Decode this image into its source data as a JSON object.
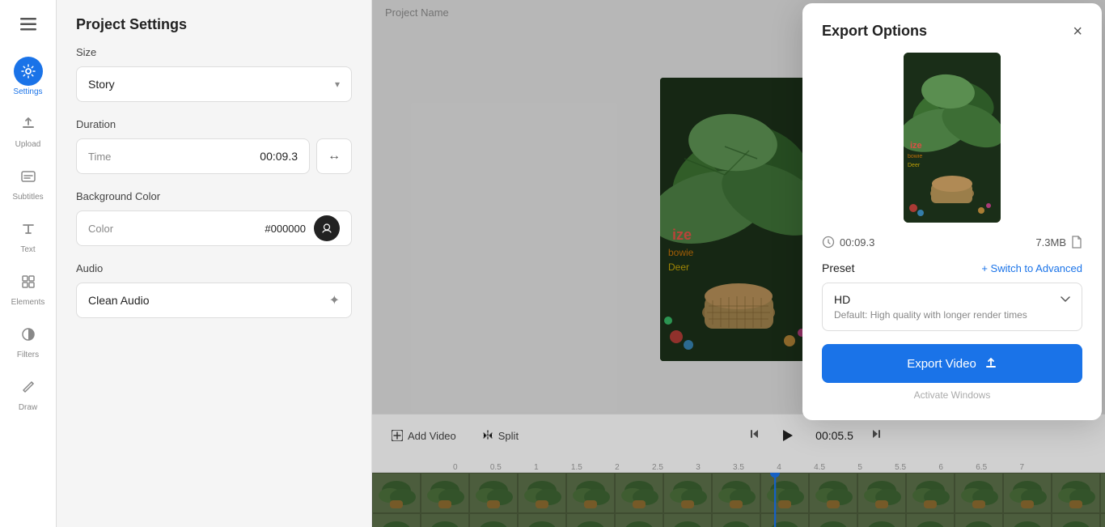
{
  "sidebar": {
    "menu_icon": "≡",
    "items": [
      {
        "id": "settings",
        "label": "Settings",
        "icon": "⚙",
        "active": true
      },
      {
        "id": "upload",
        "label": "Upload",
        "icon": "↑",
        "active": false
      },
      {
        "id": "subtitles",
        "label": "Subtitles",
        "icon": "≡",
        "active": false
      },
      {
        "id": "text",
        "label": "Text",
        "icon": "T",
        "active": false
      },
      {
        "id": "elements",
        "label": "Elements",
        "icon": "□",
        "active": false
      },
      {
        "id": "filters",
        "label": "Filters",
        "icon": "◑",
        "active": false
      },
      {
        "id": "draw",
        "label": "Draw",
        "icon": "✏",
        "active": false
      }
    ]
  },
  "settings_panel": {
    "title": "Project Settings",
    "size": {
      "label": "Size",
      "value": "Story"
    },
    "duration": {
      "label": "Duration",
      "time_label": "Time",
      "time_value": "00:09.3",
      "arrow_icon": "↔"
    },
    "background_color": {
      "label": "Background Color",
      "color_label": "Color",
      "hex_value": "#000000",
      "picker_icon": "⊕"
    },
    "audio": {
      "label": "Audio",
      "value": "Clean Audio",
      "sparkle_icon": "✦"
    }
  },
  "preview": {
    "project_name": "Project Name"
  },
  "timeline": {
    "add_video_label": "Add Video",
    "split_label": "Split",
    "time_display": "00:05.5",
    "ruler_marks": [
      "0",
      "0.5",
      "1",
      "1.5",
      "2",
      "2.5",
      "3",
      "3.5",
      "4",
      "4.5",
      "5",
      "5.5",
      "6",
      "6.5",
      "7"
    ]
  },
  "export_modal": {
    "title": "Export Options",
    "close_icon": "×",
    "duration": "00:09.3",
    "file_size": "7.3MB",
    "preset_label": "Preset",
    "switch_advanced_label": "+ Switch to Advanced",
    "preset_name": "HD",
    "preset_desc": "Default: High quality with longer render times",
    "export_button_label": "Export Video",
    "upload_icon": "↑",
    "clock_icon": "🕐",
    "file_icon": "📄"
  },
  "watermark": {
    "text": "Activate Windows"
  }
}
